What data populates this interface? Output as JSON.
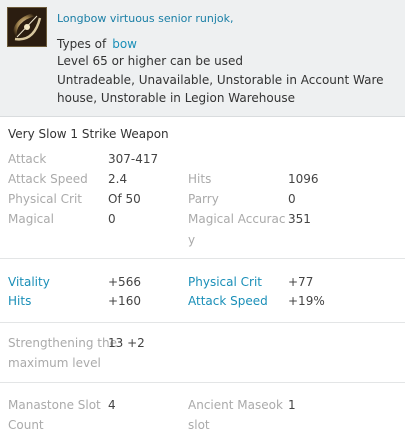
{
  "item": {
    "name": "Longbow virtuous senior runjok,",
    "type_prefix": "Types of",
    "type_value": "bow",
    "level_requirement": "Level 65 or higher can be used",
    "restrictions": "Untradeable, Unavailable, Unstorable in Account Ware house, Unstorable in Legion Warehouse",
    "icon": "longbow-item-icon"
  },
  "weapon_speed": "Very Slow 1 Strike Weapon",
  "base_stats": {
    "attack_label": "Attack",
    "attack_value": "307-417",
    "attack_speed_label": "Attack Speed",
    "attack_speed_value": "2.4",
    "hits_label": "Hits",
    "hits_value": "1096",
    "physical_crit_label": "Physical Crit",
    "physical_crit_value": "Of 50",
    "parry_label": "Parry",
    "parry_value": "0",
    "magical_label": "Magical",
    "magical_value": "0",
    "magical_accuracy_label_1": "Magical Accurac",
    "magical_accuracy_label_2": "y",
    "magical_accuracy_value": "351"
  },
  "bonus_stats": {
    "vitality_label": "Vitality",
    "vitality_value": "+566",
    "physical_crit_label": "Physical Crit",
    "physical_crit_value": "+77",
    "hits_label": "Hits",
    "hits_value": "+160",
    "attack_speed_label": "Attack Speed",
    "attack_speed_value": "+19%"
  },
  "enchant": {
    "label_1": "Strengthening the",
    "label_2": "maximum level",
    "value": "13 +2"
  },
  "slots": {
    "manastone_label_1": "Manastone Slot",
    "manastone_label_2": "Count",
    "manastone_value": "4",
    "ancient_label_1": "Ancient Maseok",
    "ancient_label_2": "slot",
    "ancient_value": "1"
  },
  "colors": {
    "header_bg": "#eef0f1",
    "item_name": "#1a7fa6",
    "bonus_label": "#1a8fb8",
    "muted_label": "#aaaaaa"
  }
}
